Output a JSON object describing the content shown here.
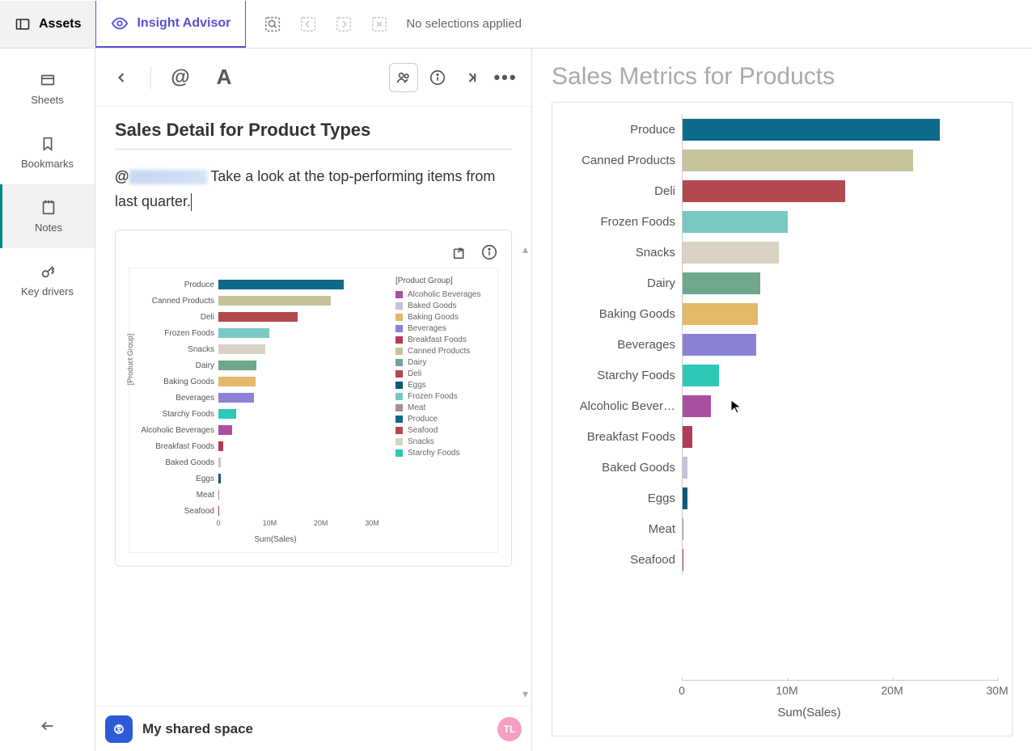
{
  "topbar": {
    "assets": "Assets",
    "insight": "Insight Advisor",
    "nosel": "No selections applied"
  },
  "sidebar": {
    "items": [
      {
        "label": "Sheets"
      },
      {
        "label": "Bookmarks"
      },
      {
        "label": "Notes"
      },
      {
        "label": "Key drivers"
      }
    ]
  },
  "note": {
    "title": "Sales Detail for Product Types",
    "mention_at": "@",
    "body": "Take a look at the top-performing items from last quarter."
  },
  "snapshot": {
    "legend_title": "[Product Group]",
    "ylabel": "[Product Group]",
    "xlabel": "Sum(Sales)",
    "ticks": [
      "0",
      "10M",
      "20M",
      "30M"
    ],
    "legend": [
      {
        "label": "Alcoholic Beverages",
        "color": "#a94f9f"
      },
      {
        "label": "Baked Goods",
        "color": "#c8c0d8"
      },
      {
        "label": "Baking Goods",
        "color": "#e4b96a"
      },
      {
        "label": "Beverages",
        "color": "#8a82d6"
      },
      {
        "label": "Breakfast Foods",
        "color": "#b43a58"
      },
      {
        "label": "Canned Products",
        "color": "#c6c39a"
      },
      {
        "label": "Dairy",
        "color": "#6fa78c"
      },
      {
        "label": "Deli",
        "color": "#b4484f"
      },
      {
        "label": "Eggs",
        "color": "#0a5a7a"
      },
      {
        "label": "Frozen Foods",
        "color": "#78c9c2"
      },
      {
        "label": "Meat",
        "color": "#a88e8e"
      },
      {
        "label": "Produce",
        "color": "#0e6a8a"
      },
      {
        "label": "Seafood",
        "color": "#b4484f"
      },
      {
        "label": "Snacks",
        "color": "#d8d2c4"
      },
      {
        "label": "Starchy Foods",
        "color": "#2cc9b7"
      }
    ]
  },
  "footer": {
    "space": "My shared space",
    "avatar": "TL"
  },
  "right_pane": {
    "title": "Sales Metrics for Products",
    "xlabel": "Sum(Sales)",
    "ticks": [
      "0",
      "10M",
      "20M",
      "30M"
    ]
  },
  "chart_data": {
    "type": "bar",
    "orientation": "horizontal",
    "title": "Sales Metrics for Products",
    "xlabel": "Sum(Sales)",
    "ylabel": "[Product Group]",
    "xlim": [
      0,
      30000000
    ],
    "categories": [
      "Produce",
      "Canned Products",
      "Deli",
      "Frozen Foods",
      "Snacks",
      "Dairy",
      "Baking Goods",
      "Beverages",
      "Starchy Foods",
      "Alcoholic Bever…",
      "Breakfast Foods",
      "Baked Goods",
      "Eggs",
      "Meat",
      "Seafood"
    ],
    "values": [
      24500000,
      22000000,
      15500000,
      10000000,
      9200000,
      7400000,
      7200000,
      7000000,
      3500000,
      2700000,
      900000,
      500000,
      500000,
      100000,
      50000
    ],
    "colors": [
      "#0e6a8a",
      "#c6c39a",
      "#b4484f",
      "#78c9c2",
      "#d8d2c4",
      "#6fa78c",
      "#e4b96a",
      "#8a82d6",
      "#2cc9b7",
      "#a94f9f",
      "#b43a58",
      "#c8c0d8",
      "#0a5a7a",
      "#a88e8e",
      "#b4484f"
    ]
  },
  "small_chart_data": {
    "type": "bar",
    "orientation": "horizontal",
    "xlabel": "Sum(Sales)",
    "ylabel": "[Product Group]",
    "xlim": [
      0,
      30000000
    ],
    "categories": [
      "Produce",
      "Canned Products",
      "Deli",
      "Frozen Foods",
      "Snacks",
      "Dairy",
      "Baking Goods",
      "Beverages",
      "Starchy Foods",
      "Alcoholic Beverages",
      "Breakfast Foods",
      "Baked Goods",
      "Eggs",
      "Meat",
      "Seafood"
    ],
    "values": [
      24500000,
      22000000,
      15500000,
      10000000,
      9200000,
      7400000,
      7200000,
      7000000,
      3500000,
      2700000,
      900000,
      500000,
      500000,
      100000,
      50000
    ],
    "colors": [
      "#0e6a8a",
      "#c6c39a",
      "#b4484f",
      "#78c9c2",
      "#d8d2c4",
      "#6fa78c",
      "#e4b96a",
      "#8a82d6",
      "#2cc9b7",
      "#a94f9f",
      "#b43a58",
      "#c8c0d8",
      "#0a5a7a",
      "#a88e8e",
      "#b4484f"
    ]
  }
}
